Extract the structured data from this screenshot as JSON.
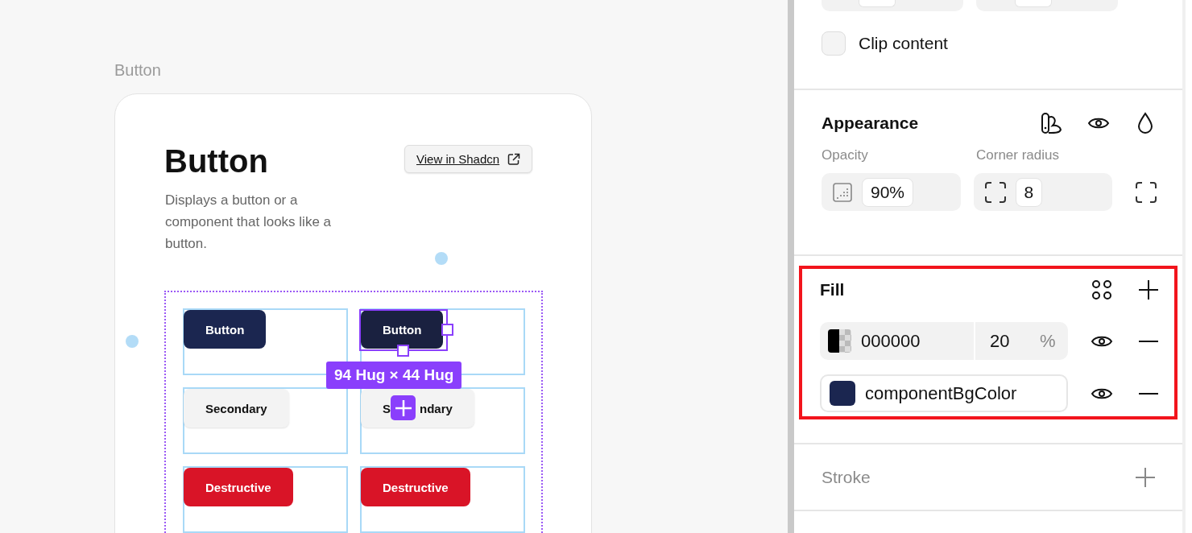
{
  "canvas": {
    "frame_label": "Button",
    "card": {
      "title": "Button",
      "description": "Displays a button or a component that looks like a button.",
      "link_button": "View in Shadcn"
    },
    "buttons": [
      {
        "label": "Button",
        "kind": "primary",
        "selected": false
      },
      {
        "label": "Button",
        "kind": "primary",
        "selected": true
      },
      {
        "label": "Secondary",
        "kind": "secondary",
        "selected": false
      },
      {
        "label_parts": [
          "S",
          "ndary"
        ],
        "kind": "secondary",
        "selected": false
      },
      {
        "label": "Destructive",
        "kind": "destructive",
        "selected": false
      },
      {
        "label": "Destructive",
        "kind": "destructive",
        "selected": false
      }
    ],
    "dimension_label": "94 Hug × 44 Hug"
  },
  "panel": {
    "clip_content": {
      "label": "Clip content",
      "checked": false
    },
    "appearance": {
      "title": "Appearance",
      "opacity_label": "Opacity",
      "opacity_value": "90%",
      "radius_label": "Corner radius",
      "radius_value": "8"
    },
    "fill": {
      "title": "Fill",
      "highlighted": true,
      "fills": [
        {
          "kind": "hex",
          "value": "000000",
          "opacity": "20",
          "unit": "%",
          "color": "#000000"
        },
        {
          "kind": "variable",
          "value": "componentBgColor",
          "color": "#1b2650"
        }
      ]
    },
    "stroke": {
      "title": "Stroke"
    }
  }
}
